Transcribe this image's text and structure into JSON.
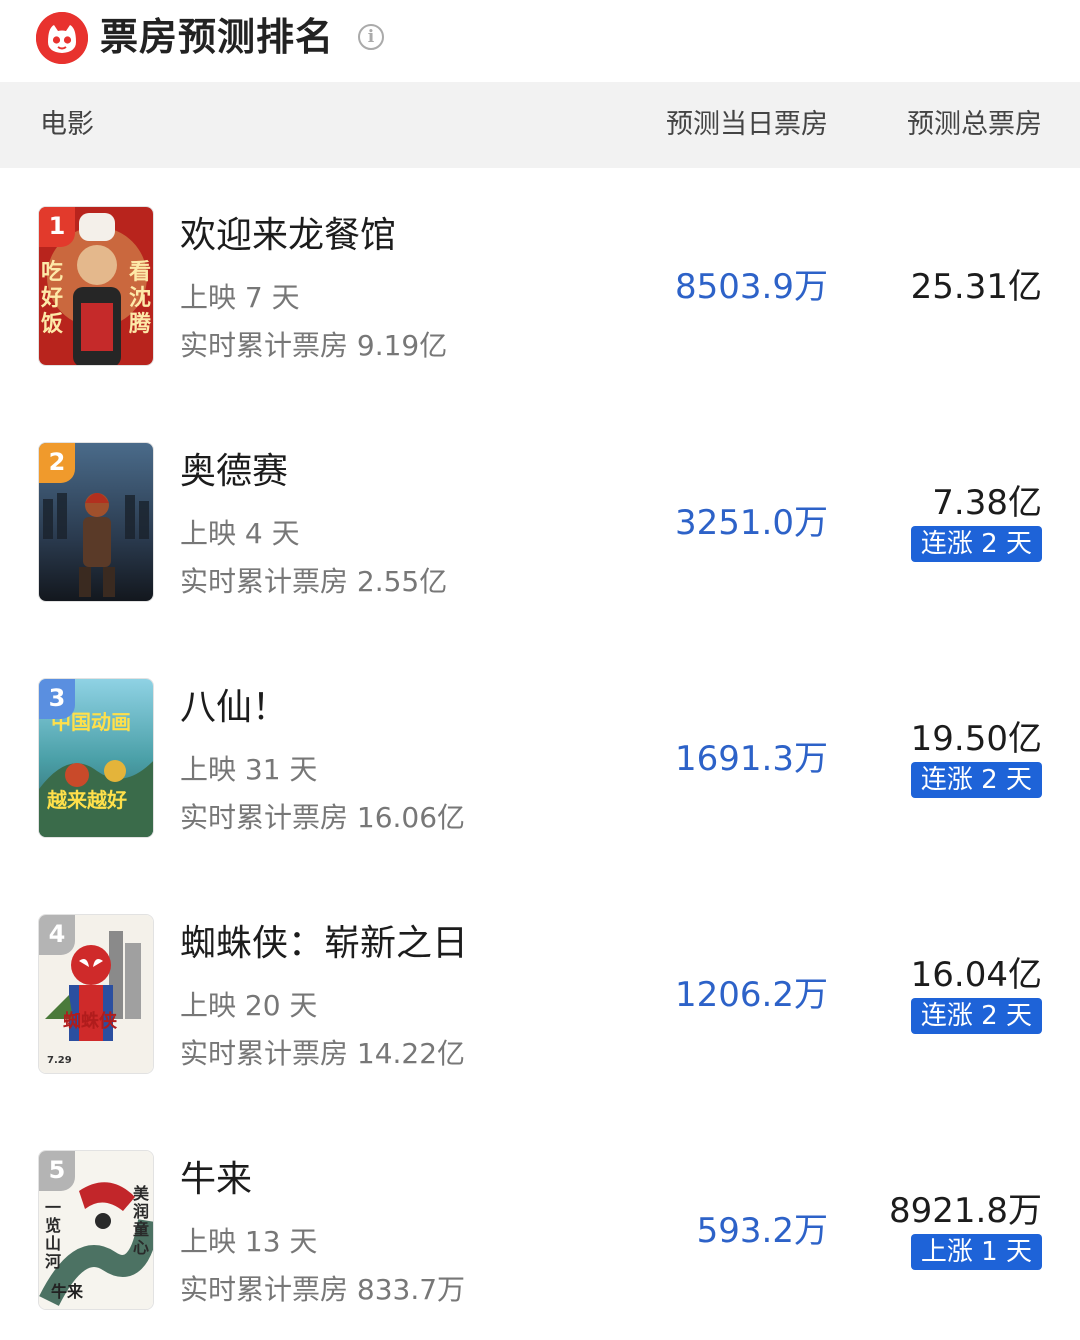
{
  "header": {
    "title": "票房预测排名",
    "logo_icon": "cat-logo-icon",
    "info_icon": "info-icon",
    "info_glyph": "i"
  },
  "columns": {
    "movie": "电影",
    "daily": "预测当日票房",
    "total": "预测总票房"
  },
  "colors": {
    "brand_red": "#e8322e",
    "daily_blue": "#2d62c8",
    "trend_badge": "#1e63d8",
    "rank1": "#e23a2c",
    "rank2": "#f09a2c",
    "rank3": "#5a8fe0",
    "rank_other": "#b4b4b4"
  },
  "movies": [
    {
      "rank": "1",
      "name": "欢迎来龙餐馆",
      "days": "上映 7 天",
      "cumulative": "实时累计票房 9.19亿",
      "daily": "8503.9万",
      "total": "25.31亿",
      "trend": ""
    },
    {
      "rank": "2",
      "name": "奥德赛",
      "days": "上映 4 天",
      "cumulative": "实时累计票房 2.55亿",
      "daily": "3251.0万",
      "total": "7.38亿",
      "trend": "连涨 2 天"
    },
    {
      "rank": "3",
      "name": "八仙！",
      "days": "上映 31 天",
      "cumulative": "实时累计票房 16.06亿",
      "daily": "1691.3万",
      "total": "19.50亿",
      "trend": "连涨 2 天"
    },
    {
      "rank": "4",
      "name": "蜘蛛侠：崭新之日",
      "days": "上映 20 天",
      "cumulative": "实时累计票房 14.22亿",
      "daily": "1206.2万",
      "total": "16.04亿",
      "trend": "连涨 2 天"
    },
    {
      "rank": "5",
      "name": "牛来",
      "days": "上映 13 天",
      "cumulative": "实时累计票房 833.7万",
      "daily": "593.2万",
      "total": "8921.8万",
      "trend": "上涨 1 天"
    }
  ]
}
